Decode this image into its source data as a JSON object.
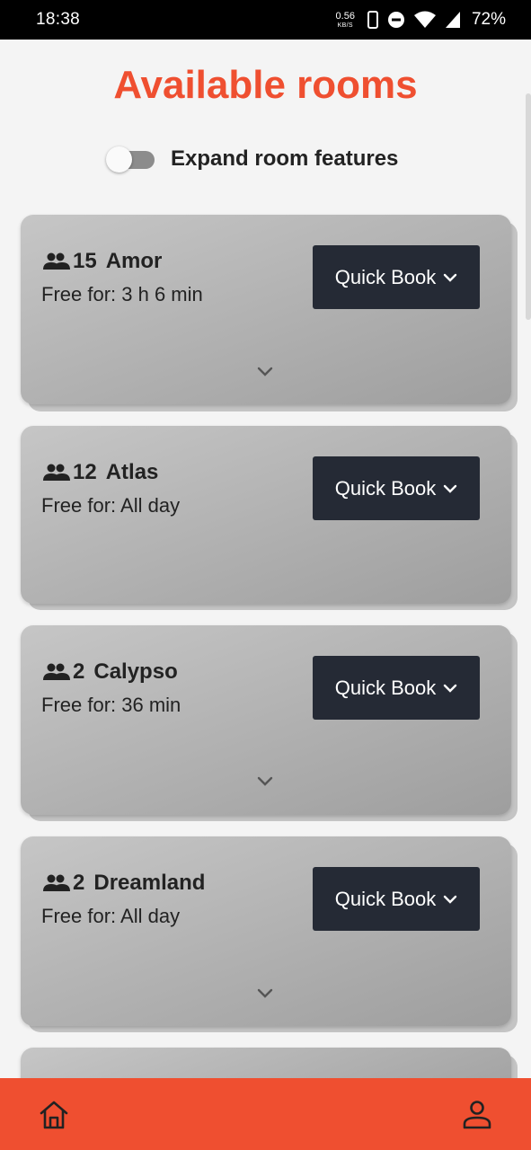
{
  "status_bar": {
    "time": "18:38",
    "net_speed_value": "0.56",
    "net_speed_unit": "KB/S",
    "battery": "72%"
  },
  "page": {
    "title": "Available rooms",
    "toggle_label": "Expand room features",
    "toggle_on": false
  },
  "rooms": [
    {
      "capacity": "15",
      "name": "Amor",
      "free_text": "Free for: 3 h 6 min",
      "button_label": "Quick Book",
      "has_expand": true
    },
    {
      "capacity": "12",
      "name": "Atlas",
      "free_text": "Free for: All day",
      "button_label": "Quick Book",
      "has_expand": false
    },
    {
      "capacity": "2",
      "name": "Calypso",
      "free_text": "Free for: 36 min",
      "button_label": "Quick Book",
      "has_expand": true
    },
    {
      "capacity": "2",
      "name": "Dreamland",
      "free_text": "Free for: All day",
      "button_label": "Quick Book",
      "has_expand": true
    }
  ],
  "icons": {
    "people": "people-icon",
    "chevron": "chevron-down-icon",
    "home": "home-icon",
    "profile": "person-icon"
  },
  "colors": {
    "accent": "#ef4f30",
    "button": "#252a35",
    "background": "#f4f4f4"
  }
}
